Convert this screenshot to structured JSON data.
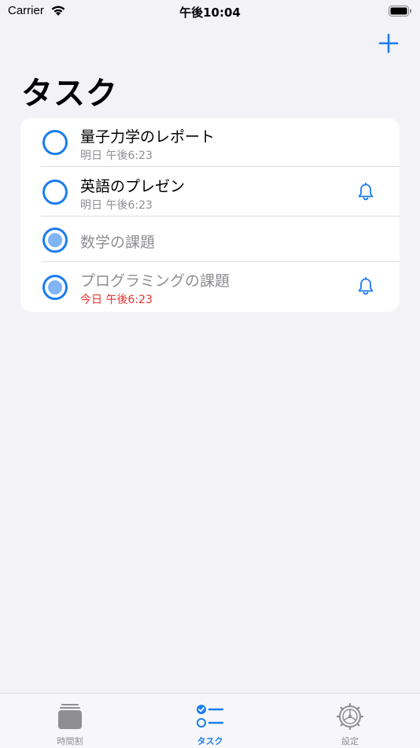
{
  "status_bar": {
    "carrier": "Carrier",
    "time": "午後10:04"
  },
  "header": {
    "title": "タスク",
    "add_icon": "plus-icon"
  },
  "tasks": [
    {
      "title": "量子力学のレポート",
      "date": "明日 午後6:23",
      "completed": false,
      "reminder": false,
      "overdue": false
    },
    {
      "title": "英語のプレゼン",
      "date": "明日 午後6:23",
      "completed": false,
      "reminder": true,
      "overdue": false
    },
    {
      "title": "数学の課題",
      "date": "",
      "completed": true,
      "reminder": false,
      "overdue": false
    },
    {
      "title": "プログラミングの課題",
      "date": "今日 午後6:23",
      "completed": true,
      "reminder": true,
      "overdue": true
    }
  ],
  "tab_bar": {
    "tabs": [
      {
        "label": "時間割",
        "icon": "timetable-icon",
        "active": false
      },
      {
        "label": "タスク",
        "icon": "tasks-checklist-icon",
        "active": true
      },
      {
        "label": "設定",
        "icon": "settings-gear-icon",
        "active": false
      }
    ]
  },
  "colors": {
    "accent": "#1a7cf0",
    "overdue": "#e8322e",
    "secondary_text": "#8e8e93",
    "background": "#f2f2f7"
  }
}
